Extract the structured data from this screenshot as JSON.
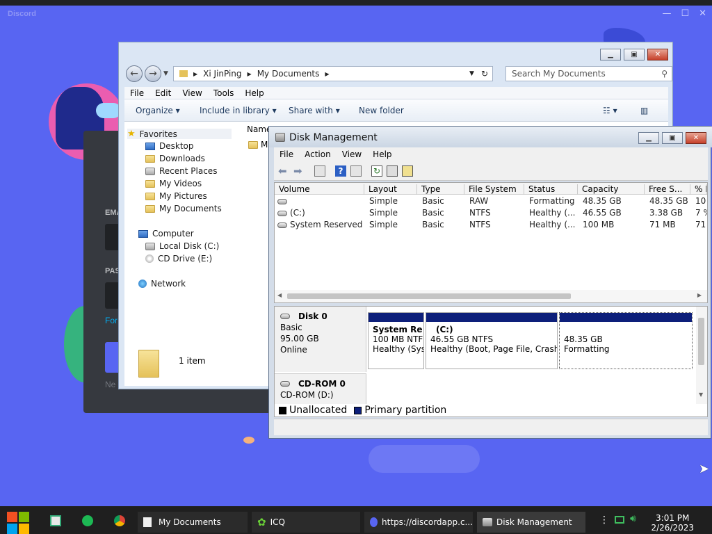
{
  "discord": {
    "brand": "Discord",
    "email_label": "EMA",
    "password_label": "PAS",
    "forgot_link": "For",
    "need_account": "Ne"
  },
  "explorer": {
    "path": [
      "Xi JinPing",
      "My Documents"
    ],
    "search_placeholder": "Search My Documents",
    "menu": [
      "File",
      "Edit",
      "View",
      "Tools",
      "Help"
    ],
    "toolbar": {
      "organize": "Organize",
      "include": "Include in library",
      "share": "Share with",
      "new_folder": "New folder"
    },
    "tree": {
      "favorites": "Favorites",
      "desktop": "Desktop",
      "downloads": "Downloads",
      "recent": "Recent Places",
      "videos": "My Videos",
      "pictures": "My Pictures",
      "documents": "My Documents",
      "computer": "Computer",
      "local_disk": "Local Disk (C:)",
      "cd_drive": "CD Drive (E:)",
      "network": "Network"
    },
    "column_name": "Name",
    "first_item": "M",
    "item_count": "1 item"
  },
  "diskmgmt": {
    "title": "Disk Management",
    "menu": [
      "File",
      "Action",
      "View",
      "Help"
    ],
    "columns": [
      "Volume",
      "Layout",
      "Type",
      "File System",
      "Status",
      "Capacity",
      "Free S...",
      "% F"
    ],
    "rows": [
      {
        "volume": "",
        "layout": "Simple",
        "type": "Basic",
        "fs": "RAW",
        "status": "Formatting",
        "capacity": "48.35 GB",
        "free": "48.35 GB",
        "pct": "10"
      },
      {
        "volume": "(C:)",
        "layout": "Simple",
        "type": "Basic",
        "fs": "NTFS",
        "status": "Healthy (...",
        "capacity": "46.55 GB",
        "free": "3.38 GB",
        "pct": "7 %"
      },
      {
        "volume": "System Reserved",
        "layout": "Simple",
        "type": "Basic",
        "fs": "NTFS",
        "status": "Healthy (...",
        "capacity": "100 MB",
        "free": "71 MB",
        "pct": "71"
      }
    ],
    "disk0": {
      "name": "Disk 0",
      "type": "Basic",
      "size": "95.00 GB",
      "state": "Online"
    },
    "partitions": [
      {
        "name": "System Re",
        "line1": "100 MB NTF",
        "line2": "Healthy (Sys"
      },
      {
        "name": "(C:)",
        "line1": "46.55 GB NTFS",
        "line2": "Healthy (Boot, Page File, Crash"
      },
      {
        "name": "",
        "line1": "48.35 GB",
        "line2": "Formatting"
      }
    ],
    "cdrom": {
      "name": "CD-ROM 0",
      "sub": "CD-ROM (D:)"
    },
    "legend": {
      "unallocated": "Unallocated",
      "primary": "Primary partition"
    }
  },
  "taskbar": {
    "tasks": [
      "My Documents",
      "ICQ",
      "https://discordapp.c...",
      "Disk Management"
    ],
    "time": "3:01 PM",
    "date": "2/26/2023"
  },
  "colors": {
    "discord_bg": "#5865f2",
    "partition_bar": "#0d1f7a",
    "taskbar": "#1f1f1f"
  }
}
